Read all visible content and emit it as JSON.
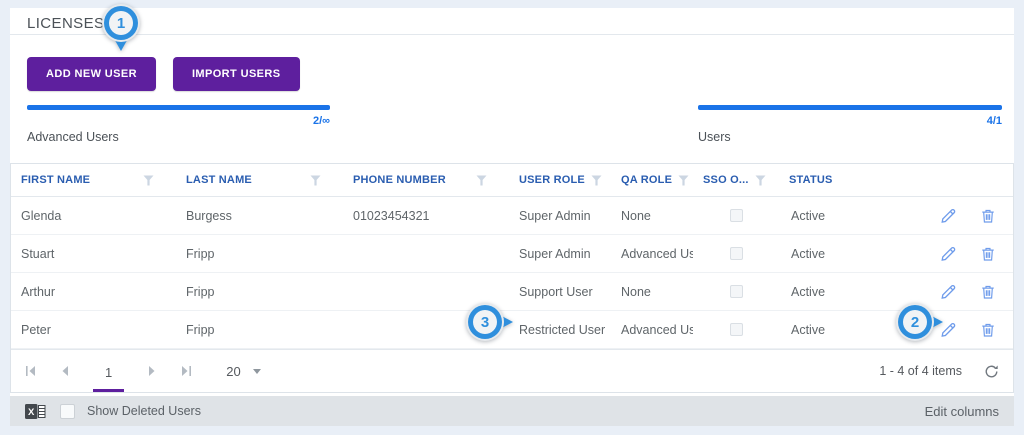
{
  "page": {
    "title": "LICENSES"
  },
  "actions": {
    "add_new_user": "ADD NEW USER",
    "import_users": "IMPORT USERS"
  },
  "meters": [
    {
      "label": "Advanced Users",
      "value": "2/∞",
      "fill_pct": 100
    },
    {
      "label": "Users",
      "value": "4/1",
      "fill_pct": 100
    }
  ],
  "table": {
    "columns": [
      {
        "label": "FIRST NAME",
        "filter": true
      },
      {
        "label": "LAST NAME",
        "filter": true
      },
      {
        "label": "PHONE NUMBER",
        "filter": true
      },
      {
        "label": "USER ROLE",
        "filter": true
      },
      {
        "label": "QA ROLE",
        "filter": true
      },
      {
        "label": "SSO O...",
        "filter": true
      },
      {
        "label": "STATUS",
        "filter": false
      }
    ],
    "rows": [
      {
        "first_name": "Glenda",
        "last_name": "Burgess",
        "phone": "01023454321",
        "user_role": "Super Admin",
        "qa_role": "None",
        "sso_checked": false,
        "status": "Active"
      },
      {
        "first_name": "Stuart",
        "last_name": "Fripp",
        "phone": "",
        "user_role": "Super Admin",
        "qa_role": "Advanced Us...",
        "sso_checked": false,
        "status": "Active"
      },
      {
        "first_name": "Arthur",
        "last_name": "Fripp",
        "phone": "",
        "user_role": "Support User",
        "qa_role": "None",
        "sso_checked": false,
        "status": "Active"
      },
      {
        "first_name": "Peter",
        "last_name": "Fripp",
        "phone": "",
        "user_role": "Restricted User",
        "qa_role": "Advanced Us...",
        "sso_checked": false,
        "status": "Active"
      }
    ]
  },
  "pager": {
    "current_page": "1",
    "page_size": "20",
    "summary": "1 - 4 of 4 items"
  },
  "footer": {
    "show_deleted_label": "Show Deleted Users",
    "edit_columns_label": "Edit columns"
  },
  "annotations": [
    {
      "number": "1",
      "direction": "down"
    },
    {
      "number": "2",
      "direction": "right"
    },
    {
      "number": "3",
      "direction": "right"
    }
  ],
  "colors": {
    "accent_purple": "#5e1f9e",
    "bar_blue": "#1a73e8",
    "header_blue": "#2a5db0",
    "callout_blue": "#2f8fdd"
  }
}
